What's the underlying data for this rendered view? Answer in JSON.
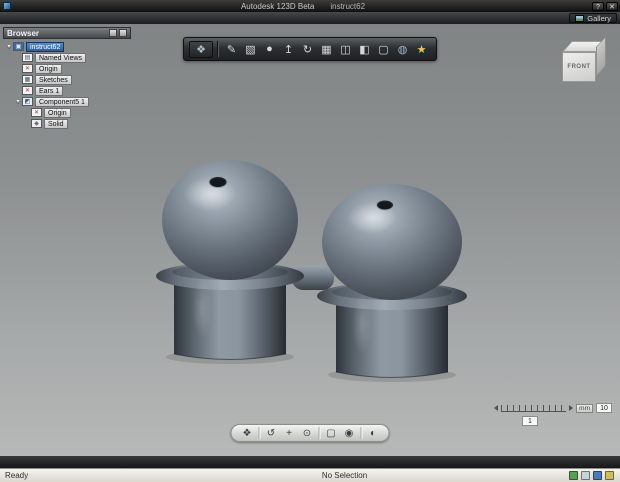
{
  "titlebar": {
    "app_title": "Autodesk 123D Beta",
    "document_title": "instruct62",
    "help_label": "?",
    "close_label": "✕"
  },
  "menubar": {
    "gallery_label": "Gallery"
  },
  "browser": {
    "title": "Browser",
    "items": [
      {
        "id": "instruct62",
        "label": "instruct62",
        "depth": 0,
        "icon": "document-icon",
        "arrow": true,
        "selected": true
      },
      {
        "id": "named-views",
        "label": "Named Views",
        "depth": 1,
        "icon": "named-views-icon",
        "arrow": false,
        "selected": false
      },
      {
        "id": "origin",
        "label": "Origin",
        "depth": 1,
        "icon": "origin-hidden-icon",
        "arrow": false,
        "selected": false
      },
      {
        "id": "sketches",
        "label": "Sketches",
        "depth": 1,
        "icon": "sketches-icon",
        "arrow": false,
        "selected": false
      },
      {
        "id": "ears-1",
        "label": "Ears 1",
        "depth": 1,
        "icon": "ears-hidden-icon",
        "arrow": false,
        "selected": false
      },
      {
        "id": "component5-1",
        "label": "Component5 1",
        "depth": 1,
        "icon": "component-icon",
        "arrow": true,
        "selected": false
      },
      {
        "id": "component-origin",
        "label": "Origin",
        "depth": 2,
        "icon": "origin-hidden-icon",
        "arrow": false,
        "selected": false
      },
      {
        "id": "solid",
        "label": "Solid",
        "depth": 2,
        "icon": "solid-icon",
        "arrow": false,
        "selected": false
      }
    ]
  },
  "toolbar": {
    "app_button_icon": "cube-3d-icon",
    "icons": [
      {
        "name": "sketch-icon"
      },
      {
        "name": "primitive-box-icon"
      },
      {
        "name": "primitive-sphere-icon"
      },
      {
        "name": "extrude-icon"
      },
      {
        "name": "revolve-icon"
      },
      {
        "name": "pattern-icon"
      },
      {
        "name": "combine-icon"
      },
      {
        "name": "split-icon"
      },
      {
        "name": "shell-icon"
      },
      {
        "name": "material-icon"
      },
      {
        "name": "favorites-icon"
      }
    ]
  },
  "viewcube": {
    "front_label": "FRONT"
  },
  "scale": {
    "unit_label": "mm",
    "major_value": "10",
    "minor_value": "1"
  },
  "bottom_toolbar": {
    "icons": [
      {
        "name": "view-menu-icon",
        "sep_after": true
      },
      {
        "name": "orbit-icon",
        "sep_after": false
      },
      {
        "name": "pan-icon",
        "sep_after": false
      },
      {
        "name": "zoom-icon",
        "sep_after": true
      },
      {
        "name": "fit-view-icon",
        "sep_after": false
      },
      {
        "name": "look-at-icon",
        "sep_after": true
      },
      {
        "name": "display-settings-icon",
        "sep_after": false
      }
    ]
  },
  "statusbar": {
    "left_text": "Ready",
    "center_text": "No Selection",
    "icons": [
      {
        "name": "snap-mode-indicator",
        "color": "#55a055"
      },
      {
        "name": "grid-indicator",
        "color": "#c9d2d8"
      },
      {
        "name": "sync-indicator",
        "color": "#4a7ab8"
      },
      {
        "name": "warning-indicator",
        "color": "#cdbd5e"
      }
    ]
  },
  "colors": {
    "selection_blue": "#3f6fb0",
    "canvas_top": "#818485",
    "canvas_bottom": "#b6b9b7",
    "model_steel": "#6a757f"
  }
}
